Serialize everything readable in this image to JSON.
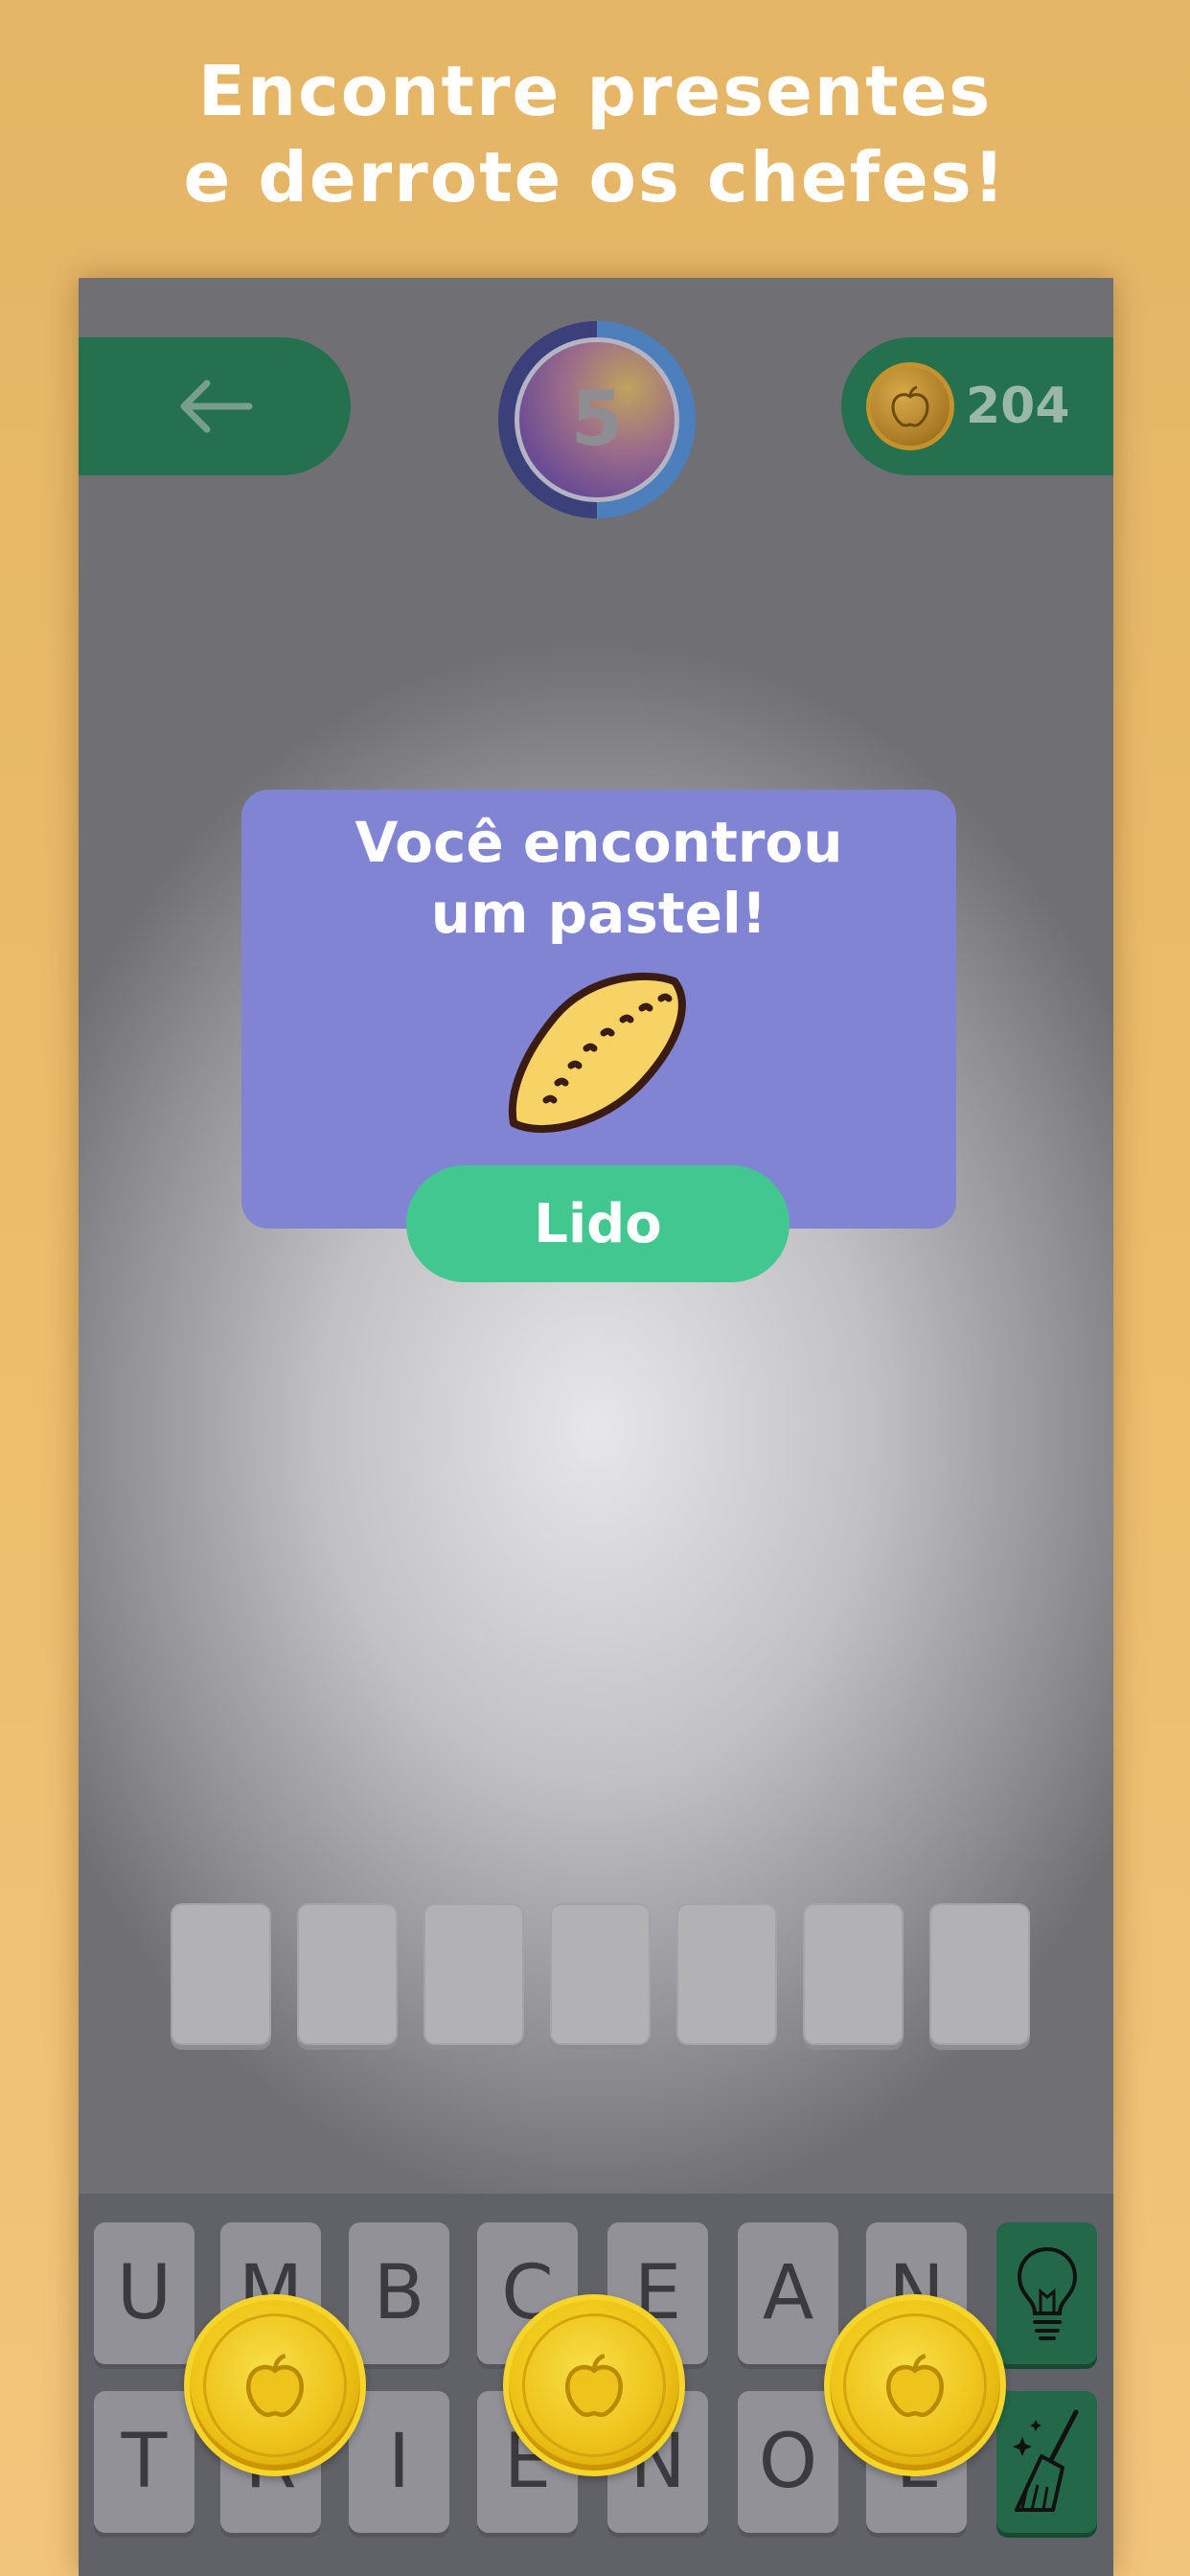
{
  "promo": {
    "headline_line1": "Encontre presentes",
    "headline_line2": "e derrote os chefes!"
  },
  "header": {
    "back_icon": "arrow-left-icon",
    "level": "5",
    "coins": "204",
    "coin_icon": "apple-coin-icon"
  },
  "dialog": {
    "title_line1": "Você encontrou",
    "title_line2": "um pastel!",
    "image_icon": "pastel-icon",
    "button_label": "Lido"
  },
  "answer": {
    "slot_count": 7
  },
  "keyboard": {
    "row1": [
      "U",
      "M",
      "B",
      "C",
      "E",
      "A",
      "N"
    ],
    "row2": [
      "T",
      "R",
      "I",
      "E",
      "N",
      "O",
      "L"
    ],
    "hint_icon": "lightbulb-icon",
    "clear_icon": "broom-icon"
  },
  "colors": {
    "background": "#eebd6f",
    "dialog": "#8184d2",
    "button": "#42c790",
    "pill": "#24704f"
  }
}
